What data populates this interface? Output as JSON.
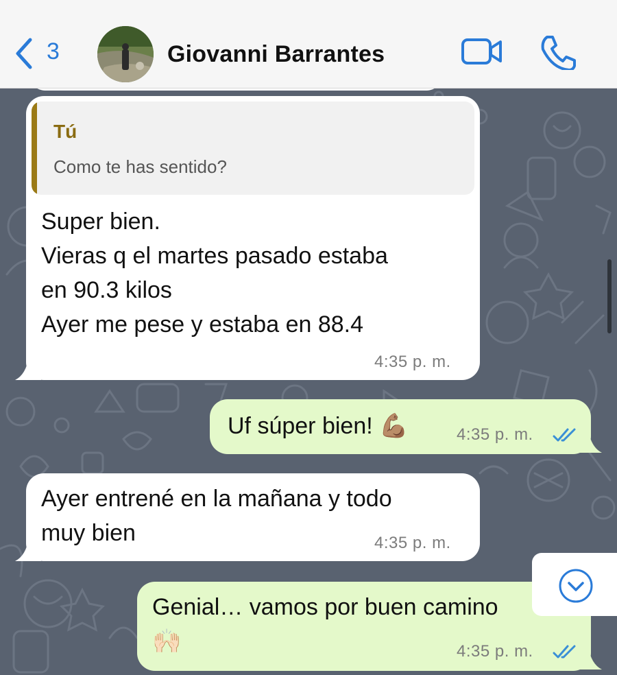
{
  "header": {
    "back_count": "3",
    "contact_name": "Giovanni Barrantes",
    "accent_color": "#2a7bd8"
  },
  "messages": [
    {
      "direction": "incoming",
      "quote": {
        "author": "Tú",
        "text": "Como te has sentido?"
      },
      "text": "Super bien.\nVieras q el martes pasado estaba\nen 90.3 kilos\nAyer me pese y estaba en 88.4",
      "time": "4:35 p. m."
    },
    {
      "direction": "outgoing",
      "text": "Uf súper bien! 💪🏽",
      "time": "4:35 p. m.",
      "status": "read"
    },
    {
      "direction": "incoming",
      "text": "Ayer entrené en la mañana y todo\nmuy bien",
      "time": "4:35 p. m."
    },
    {
      "direction": "outgoing",
      "text": "Genial… vamos por buen camino\n🙌🏻",
      "time": "4:35 p. m.",
      "status": "read"
    }
  ],
  "colors": {
    "incoming_bubble": "#ffffff",
    "outgoing_bubble": "#e4f9ca",
    "wallpaper": "#596270",
    "read_ticks": "#3a8fd6",
    "quote_accent": "#9b7a16"
  },
  "icons": [
    "back-chevron-icon",
    "video-call-icon",
    "phone-icon",
    "scroll-down-chevron-icon",
    "read-ticks-icon"
  ]
}
